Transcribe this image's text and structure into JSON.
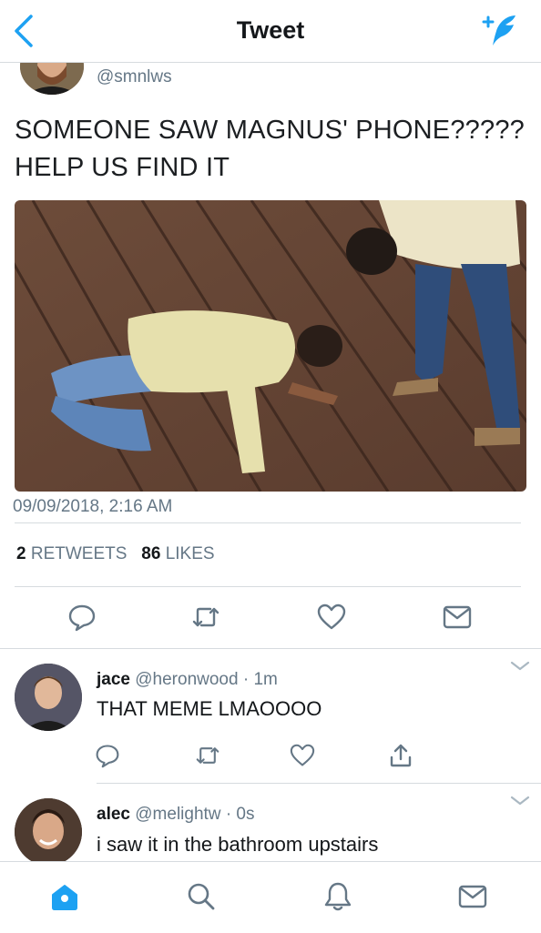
{
  "header": {
    "title": "Tweet"
  },
  "tweet": {
    "handle": "@smnlws",
    "text": "SOMEONE SAW MAGNUS' PHONE????? HELP US FIND IT",
    "timestamp": "09/09/2018, 2:16 AM",
    "retweets_count": "2",
    "retweets_label": "RETWEETS",
    "likes_count": "86",
    "likes_label": "LIKES"
  },
  "replies": [
    {
      "name": "jace",
      "handle": "@heronwood",
      "sep": "·",
      "time": "1m",
      "text": "THAT MEME LMAOOOO"
    },
    {
      "name": "alec",
      "handle": "@melightw",
      "sep": "·",
      "time": "0s",
      "text": "i saw it in the bathroom upstairs"
    }
  ],
  "colors": {
    "accent": "#1da1f2",
    "muted": "#657786",
    "divider": "#d6dbdf"
  },
  "icons": {
    "header": [
      "back-chevron-icon",
      "compose-tweet-icon"
    ],
    "actions": [
      "reply-icon",
      "retweet-icon",
      "like-icon",
      "direct-message-icon"
    ],
    "reply_actions": [
      "reply-icon",
      "retweet-icon",
      "like-icon",
      "share-icon"
    ],
    "tabs": [
      "home-icon",
      "search-icon",
      "notifications-icon",
      "messages-icon"
    ]
  }
}
